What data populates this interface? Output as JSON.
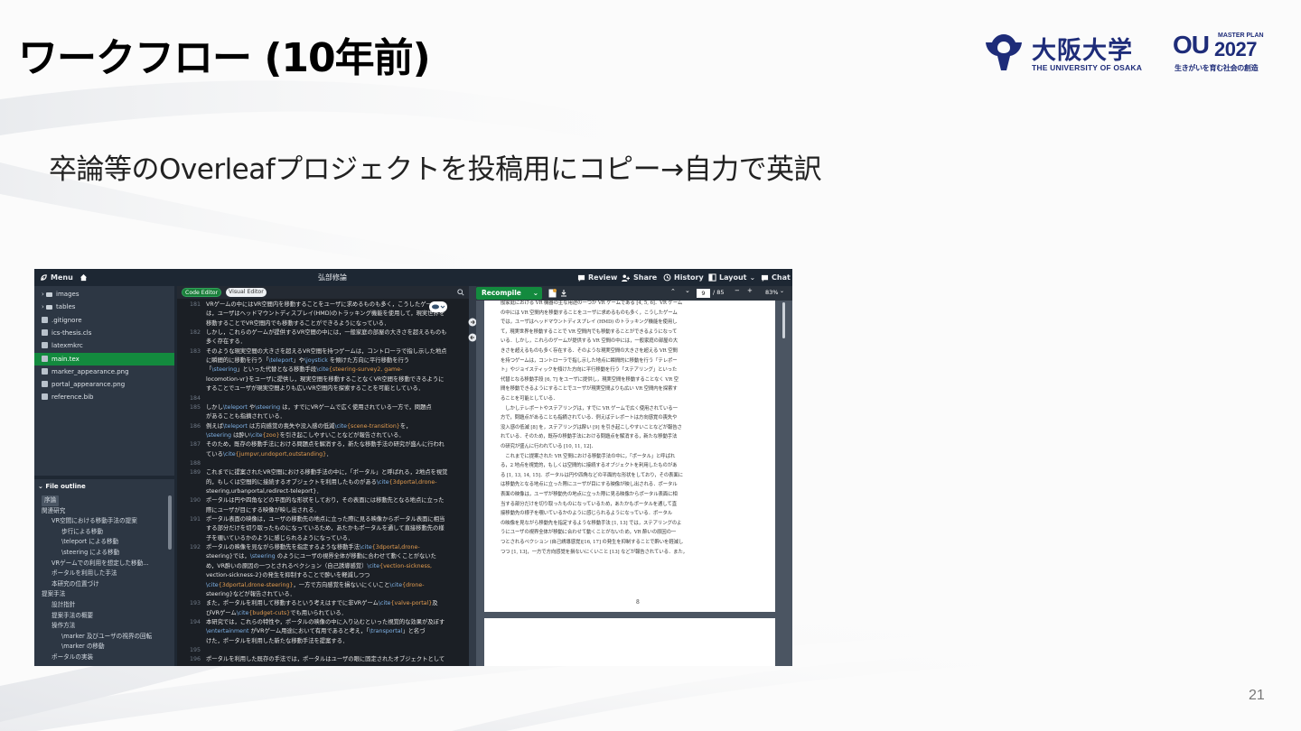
{
  "slide": {
    "title": "ワークフロー (10年前)",
    "subtitle": "卒論等のOverleafプロジェクトを投稿用にコピー→自力で英訳",
    "page_number": "21",
    "logos": {
      "ou_name": "大阪大学",
      "ou_sub": "THE UNIVERSITY OF OSAKA",
      "mp_top": "MASTER PLAN",
      "mp_ou": "OU",
      "mp_year": "2027",
      "mp_sub": "生きがいを育む社会の創造"
    },
    "colors": {
      "brand_navy": "#1e2c79",
      "overleaf_green": "#138a3e"
    }
  },
  "overleaf": {
    "topbar": {
      "menu": "Menu",
      "project": "弘部修論",
      "review": "Review",
      "share": "Share",
      "history": "History",
      "layout": "Layout",
      "chat": "Chat"
    },
    "files": [
      {
        "name": "images",
        "kind": "folder"
      },
      {
        "name": "tables",
        "kind": "folder"
      },
      {
        "name": ".gitignore",
        "kind": "file"
      },
      {
        "name": "ics-thesis.cls",
        "kind": "file"
      },
      {
        "name": "latexmkrc",
        "kind": "file"
      },
      {
        "name": "main.tex",
        "kind": "file",
        "active": true
      },
      {
        "name": "marker_appearance.png",
        "kind": "image"
      },
      {
        "name": "portal_appearance.png",
        "kind": "image"
      },
      {
        "name": "reference.bib",
        "kind": "bib"
      }
    ],
    "outline_title": "File outline",
    "outline": [
      {
        "label": "序論",
        "level": 0,
        "selected": true
      },
      {
        "label": "関連研究",
        "level": 0
      },
      {
        "label": "VR空間における移動手法の提案",
        "level": 1
      },
      {
        "label": "歩行による移動",
        "level": 2
      },
      {
        "label": "\\teleport による移動",
        "level": 2
      },
      {
        "label": "\\steering による移動",
        "level": 2
      },
      {
        "label": "VRゲームでの利用を想定した移動...",
        "level": 1
      },
      {
        "label": "ポータルを利用した手法",
        "level": 1
      },
      {
        "label": "本研究の位置づけ",
        "level": 1
      },
      {
        "label": "提案手法",
        "level": 0
      },
      {
        "label": "設計指針",
        "level": 1
      },
      {
        "label": "提案手法の概要",
        "level": 1
      },
      {
        "label": "操作方法",
        "level": 1
      },
      {
        "label": "\\marker 及びユーザの視界の回転",
        "level": 2
      },
      {
        "label": "\\marker の移動",
        "level": 2
      },
      {
        "label": "ポータルの実装",
        "level": 1
      }
    ],
    "editor": {
      "code_toggle": "Code Editor",
      "visual_toggle": "Visual Editor",
      "lines": [
        {
          "n": "181",
          "t": "VRゲームの中にはVR空間内を移動することをユーザに求めるものも多く，こうしたゲーム"
        },
        {
          "n": "",
          "t": "は，ユーザはヘッドマウントディスプレイ(HMD)のトラッキング機能を使用して，現実世界を"
        },
        {
          "n": "",
          "t": "移動することでVR空間内でも移動することができるようになっている．"
        },
        {
          "n": "182",
          "t": "しかし，これらのゲームが提供するVR空間の中には，一般家庭の部屋の大きさを超えるものも"
        },
        {
          "n": "",
          "t": "多く存在する．"
        },
        {
          "n": "183",
          "t": "そのような現実空間の大きさを超えるVR空間を持つゲームは，コントローラで指し示した地点"
        },
        {
          "n": "",
          "t": "に瞬間的に移動を行う「\\teleport」や\\joystick を傾けた方向に平行移動を行う"
        },
        {
          "n": "",
          "t": "「\\steering」といった代替となる移動手段\\cite{steering-survey2, game-"
        },
        {
          "n": "",
          "t": "locomotion-vr}をユーザに提供し，現実空間を移動することなくVR空間を移動できるように"
        },
        {
          "n": "",
          "t": "することでユーザが現実空間よりも広いVR空間内を探索することを可能としている．"
        },
        {
          "n": "184",
          "t": ""
        },
        {
          "n": "185",
          "t": "しかし\\teleport や\\steering は，すでにVRゲームで広く使用されている一方で，問題点"
        },
        {
          "n": "",
          "t": "があることも指摘されている．"
        },
        {
          "n": "186",
          "t": "例えば\\teleport は方向感覚の喪失や没入感の低減\\cite{scene-transition}を，"
        },
        {
          "n": "",
          "t": "\\steering は酔い\\cite{zoo}を引き起こしやすいことなどが報告されている．"
        },
        {
          "n": "187",
          "t": "そのため，既存の移動手法における問題点を解消する，新たな移動手法の研究が盛んに行われ"
        },
        {
          "n": "",
          "t": "ている\\cite{jumpvr,undoport,outstanding}．"
        },
        {
          "n": "188",
          "t": ""
        },
        {
          "n": "189",
          "t": "これまでに提案されたVR空間における移動手法の中に，「ポータル」と呼ばれる，2地点を視覚"
        },
        {
          "n": "",
          "t": "的，もしくは空間的に接続するオブジェクトを利用したものがある\\cite{3dportal,drone-"
        },
        {
          "n": "",
          "t": "steering,urbanportal,redirect-teleport}．"
        },
        {
          "n": "190",
          "t": "ポータルは円や四角などの平面的な形状をしており，その表面には移動先となる地点に立った"
        },
        {
          "n": "",
          "t": "際にユーザが目にする映像が映し出される．"
        },
        {
          "n": "191",
          "t": "ポータル表面の映像は，ユーザの移動先の地点に立った際に見る映像からポータル表面に相当"
        },
        {
          "n": "",
          "t": "する部分だけを切り取ったものになっているため，あたかもポータルを通して直接移動先の様"
        },
        {
          "n": "",
          "t": "子を覗いているかのように感じられるようになっている．"
        },
        {
          "n": "192",
          "t": "ポータルの映像を見ながら移動先を指定するような移動手法\\cite{3dportal,drone-"
        },
        {
          "n": "",
          "t": "steering}では，\\steering のようにユーザの視界全体が移動に合わせて動くことがないた"
        },
        {
          "n": "",
          "t": "め，VR酔いの原因の一つとされるベクション（自己誘導感覚）\\cite{vection-sickness,"
        },
        {
          "n": "",
          "t": "vection-sickness-2}の発生を抑制することで酔いを軽減しつつ"
        },
        {
          "n": "",
          "t": "\\cite{3dportal,drone-steering}，一方で方向感覚を損ないにくいこと\\cite{drone-"
        },
        {
          "n": "",
          "t": "steering}などが報告されている．"
        },
        {
          "n": "193",
          "t": "また，ポータルを利用して移動するという考えはすでに非VRゲーム\\cite{valve-portal}及"
        },
        {
          "n": "",
          "t": "びVRゲーム\\cite{budget-cuts}でも用いられている．"
        },
        {
          "n": "194",
          "t": "本研究では，これらの特性や，ポータルの映像の中に入り込むといった視覚的な効果が及ぼす"
        },
        {
          "n": "",
          "t": "\\entertainment がVRゲーム用途において有用であると考え，「\\transportal」と名づ"
        },
        {
          "n": "",
          "t": "けた，ポータルを利用した新たな移動手法を提案する．"
        },
        {
          "n": "195",
          "t": ""
        },
        {
          "n": "196",
          "t": "ポータルを利用した既存の手法では，ポータルはユーザの眼に固定されたオブジェクトとして"
        }
      ]
    },
    "pdf": {
      "recompile": "Recompile",
      "page_input": "9",
      "page_total": "/ 85",
      "zoom": "83%",
      "page_number": "8",
      "lines": [
        "般家庭における VR 機器の主な用途の一つが VR ゲームである [4, 5, 6]．VR ゲーム",
        "の中には VR 空間内を移動することをユーザに求めるものも多く，こうしたゲーム",
        "では，ユーザはヘッドマウントディスプレイ (HMD) のトラッキング機能を使用し",
        "て，現実世界を移動することで VR 空間内でも移動することができるようになって",
        "いる．しかし，これらのゲームが提供する VR 空間の中には，一般家庭の部屋の大",
        "きさを超えるものも多く存在する．そのような現実空間の大きさを超える VR 空間",
        "を持つゲームは，コントローラで指し示した地点に瞬間的に移動を行う「テレポー",
        "ト」やジョイスティックを傾けた方向に平行移動を行う「ステアリング」といった",
        "代替となる移動手段 [6, 7] をユーザに提供し，現実空間を移動することなく VR 空",
        "間を移動できるようにすることでユーザが現実空間よりも広い VR 空間内を探索す",
        "ることを可能としている．",
        "　しかしテレポートやステアリングは，すでに VR ゲームで広く使用されている一",
        "方で，問題点があることも指摘されている．例えばテレポートは方向感覚の喪失や",
        "没入感の低減 [8] を，ステアリングは酔い [9] を引き起こしやすいことなどが報告さ",
        "れている．そのため，既存の移動手法における問題点を解消する，新たな移動手法",
        "の研究が盛んに行われている [10, 11, 12]．",
        "　これまでに提案された VR 空間における移動手法の中に，「ポータル」と呼ばれ",
        "る，2 地点を視覚的，もしくは空間的に接続するオブジェクトを利用したものがあ",
        "る [1, 13, 14, 15]．ポータルは円や四角などの平面的な形状をしており，その表面に",
        "は移動先となる地点に立った際にユーザが目にする映像が映し出される．ポータル",
        "表面の映像は，ユーザが移動先の地点に立った際に見る映像からポータル表面に相",
        "当する部分だけを切り取ったものになっているため，あたかもポータルを通して直",
        "接移動先の様子を覗いているかのように感じられるようになっている．ポータル",
        "の映像を見ながら移動先を指定するような移動手法 [1, 13] では，ステアリングのよ",
        "うにユーザの視界全体が移動に合わせて動くことがないため，VR 酔いの原因の一",
        "つとされるベクション (自己誘導感覚)[16, 17] の発生を抑制することで酔いを軽減し",
        "つつ [1, 13]，一方で方向感覚を損ないにくいこと [13] などが報告されている．また，"
      ]
    }
  }
}
